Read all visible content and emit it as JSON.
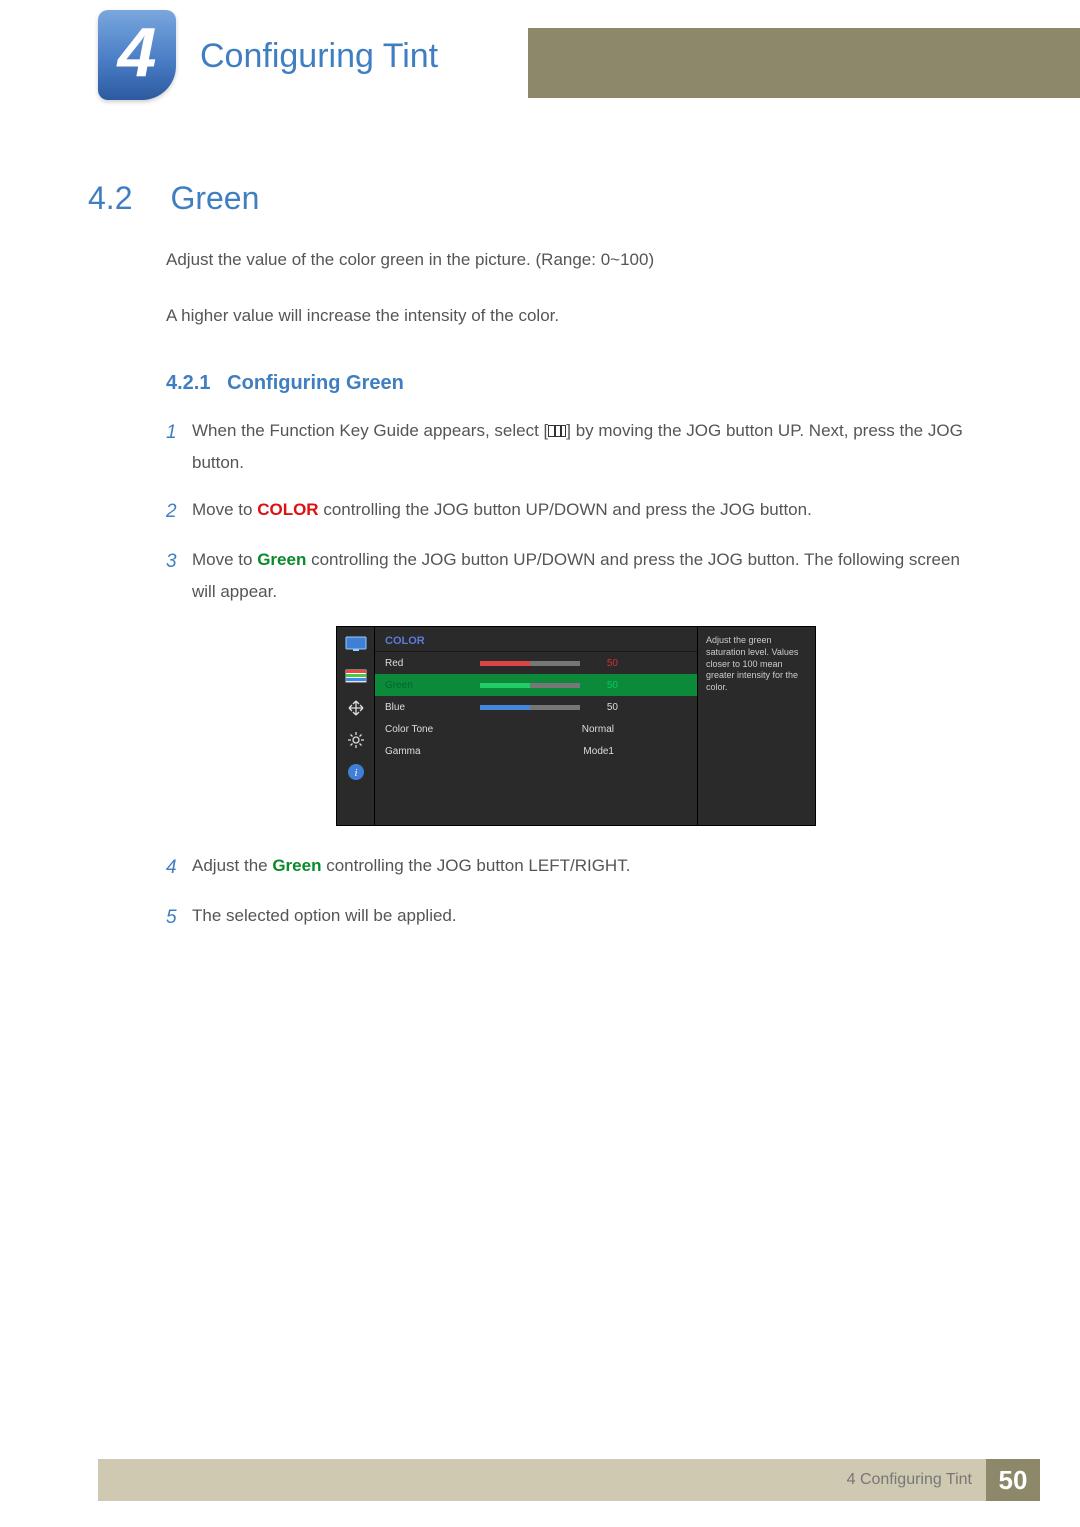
{
  "chapter": {
    "number": "4",
    "title": "Configuring Tint"
  },
  "section": {
    "number": "4.2",
    "title": "Green"
  },
  "intro": {
    "p1": "Adjust the value of the color green in the picture. (Range: 0~100)",
    "p2": "A higher value will increase the intensity of the color."
  },
  "subsection": {
    "number": "4.2.1",
    "title": "Configuring Green"
  },
  "steps": {
    "s1a": "When the Function Key Guide appears, select [",
    "s1b": "] by moving the JOG button UP. Next, press the JOG button.",
    "s2a": "Move to ",
    "s2color": "COLOR",
    "s2b": " controlling the JOG button UP/DOWN and press the JOG button.",
    "s3a": "Move to ",
    "s3green": "Green",
    "s3b": " controlling the JOG button UP/DOWN and press the JOG button. The following screen will appear.",
    "s4a": "Adjust the ",
    "s4green": "Green",
    "s4b": " controlling the JOG button LEFT/RIGHT.",
    "s5": "The selected option will be applied."
  },
  "step_numbers": {
    "n1": "1",
    "n2": "2",
    "n3": "3",
    "n4": "4",
    "n5": "5"
  },
  "osd": {
    "title": "COLOR",
    "rows": {
      "red": {
        "label": "Red",
        "value": "50"
      },
      "green": {
        "label": "Green",
        "value": "50"
      },
      "blue": {
        "label": "Blue",
        "value": "50"
      },
      "tone": {
        "label": "Color Tone",
        "value": "Normal"
      },
      "gamma": {
        "label": "Gamma",
        "value": "Mode1"
      }
    },
    "help": "Adjust the green saturation level. Values closer to 100 mean greater intensity for the color."
  },
  "footer": {
    "label": "4 Configuring Tint",
    "page": "50"
  }
}
